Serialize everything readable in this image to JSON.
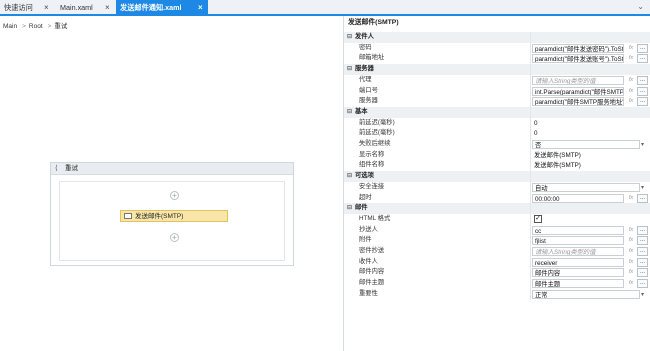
{
  "tabs": [
    {
      "label": "快速访问",
      "active": false
    },
    {
      "label": "Main.xaml",
      "active": false
    },
    {
      "label": "发送邮件通知.xaml",
      "active": true
    }
  ],
  "breadcrumb": [
    "Main",
    "Root",
    "重试"
  ],
  "canvas": {
    "sequence_title": "重试",
    "activity_label": "发送邮件(SMTP)"
  },
  "properties": {
    "title": "发送邮件(SMTP)",
    "rows": [
      {
        "kind": "cat",
        "label": "发件人"
      },
      {
        "kind": "prop",
        "name": "密码",
        "value": "paramdict(\"邮件发送密码\").ToSt",
        "boxed": true,
        "fx": true,
        "dots": true
      },
      {
        "kind": "prop",
        "name": "邮箱地址",
        "value": "paramdict(\"邮件发送账号\").ToSt",
        "boxed": true,
        "fx": true,
        "dots": true
      },
      {
        "kind": "cat",
        "label": "服务器"
      },
      {
        "kind": "prop",
        "name": "代理",
        "value": "请输入String类型的值",
        "boxed": true,
        "placeholder": true,
        "fx": true,
        "dots": true
      },
      {
        "kind": "prop",
        "name": "端口号",
        "value": "int.Parse(paramdict(\"邮件SMTP",
        "boxed": true,
        "fx": true,
        "dots": true
      },
      {
        "kind": "prop",
        "name": "服务器",
        "value": "paramdict(\"邮件SMTP服务地址\")",
        "boxed": true,
        "fx": true,
        "dots": true
      },
      {
        "kind": "cat",
        "label": "基本"
      },
      {
        "kind": "prop",
        "name": "前延迟(毫秒)",
        "value": "0"
      },
      {
        "kind": "prop",
        "name": "前延迟(毫秒)",
        "value": "0"
      },
      {
        "kind": "prop",
        "name": "失败后继续",
        "value": "否",
        "boxed": true,
        "dropdown": true
      },
      {
        "kind": "prop",
        "name": "显示名称",
        "value": "发送邮件(SMTP)"
      },
      {
        "kind": "prop",
        "name": "组件名称",
        "value": "发送邮件(SMTP)"
      },
      {
        "kind": "cat",
        "label": "可选项"
      },
      {
        "kind": "prop",
        "name": "安全连接",
        "value": "自动",
        "boxed": true,
        "dropdown": true
      },
      {
        "kind": "prop",
        "name": "超时",
        "value": "00:00:00",
        "boxed": true,
        "fx": true,
        "dots": true
      },
      {
        "kind": "cat",
        "label": "邮件"
      },
      {
        "kind": "prop",
        "name": "HTML 格式",
        "checkbox": true,
        "checked": true
      },
      {
        "kind": "prop",
        "name": "抄送人",
        "value": "cc",
        "boxed": true,
        "fx": true,
        "dots": true
      },
      {
        "kind": "prop",
        "name": "附件",
        "value": "fjlist",
        "boxed": true,
        "fx": true,
        "dots": true
      },
      {
        "kind": "prop",
        "name": "密件抄送",
        "value": "请输入String类型的值",
        "boxed": true,
        "placeholder": true,
        "fx": true,
        "dots": true
      },
      {
        "kind": "prop",
        "name": "收件人",
        "value": "receiver",
        "boxed": true,
        "fx": true,
        "dots": true
      },
      {
        "kind": "prop",
        "name": "邮件内容",
        "value": "邮件内容",
        "boxed": true,
        "fx": true,
        "dots": true
      },
      {
        "kind": "prop",
        "name": "邮件主题",
        "value": "邮件主题",
        "boxed": true,
        "fx": true,
        "dots": true
      },
      {
        "kind": "prop",
        "name": "重要性",
        "value": "正常",
        "boxed": true,
        "dropdown": true
      }
    ]
  }
}
